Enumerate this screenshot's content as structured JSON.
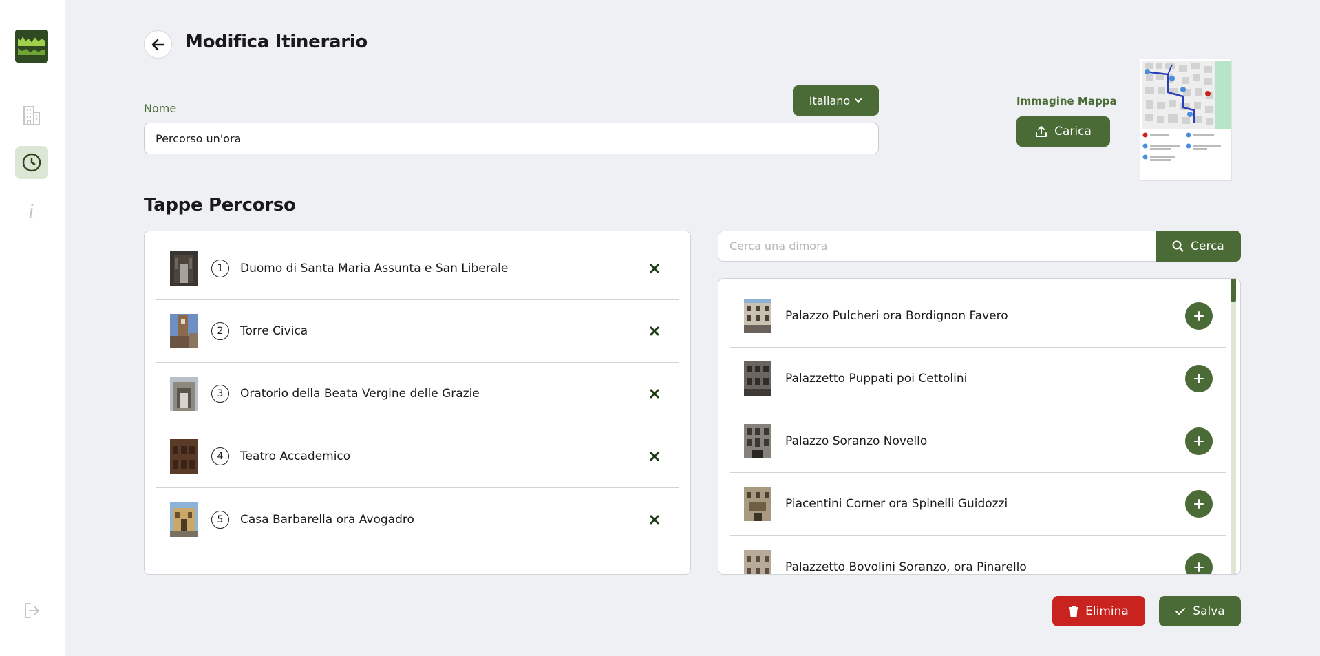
{
  "header": {
    "title": "Modifica Itinerario"
  },
  "form": {
    "name_label": "Nome",
    "name_value": "Percorso un'ora",
    "language": "Italiano",
    "map_label": "Immagine Mappa",
    "upload_label": "Carica"
  },
  "stops": {
    "title": "Tappe Percorso",
    "items": [
      {
        "number": "1",
        "name": "Duomo di Santa Maria Assunta e San Liberale"
      },
      {
        "number": "2",
        "name": "Torre Civica"
      },
      {
        "number": "3",
        "name": "Oratorio della Beata Vergine delle Grazie"
      },
      {
        "number": "4",
        "name": "Teatro Accademico"
      },
      {
        "number": "5",
        "name": "Casa Barbarella ora Avogadro"
      }
    ]
  },
  "search": {
    "placeholder": "Cerca una dimora",
    "button_label": "Cerca"
  },
  "results": {
    "items": [
      {
        "name": "Palazzo Pulcheri ora Bordignon Favero"
      },
      {
        "name": "Palazzetto Puppati poi Cettolini"
      },
      {
        "name": "Palazzo Soranzo Novello"
      },
      {
        "name": "Piacentini Corner ora Spinelli Guidozzi"
      },
      {
        "name": "Palazzetto Bovolini Soranzo, ora Pinarello"
      }
    ]
  },
  "actions": {
    "delete_label": "Elimina",
    "save_label": "Salva"
  },
  "colors": {
    "primary": "#4a6b35",
    "danger": "#c8231f",
    "active_nav_bg": "#dbe6d4",
    "background": "#eef0f4"
  }
}
